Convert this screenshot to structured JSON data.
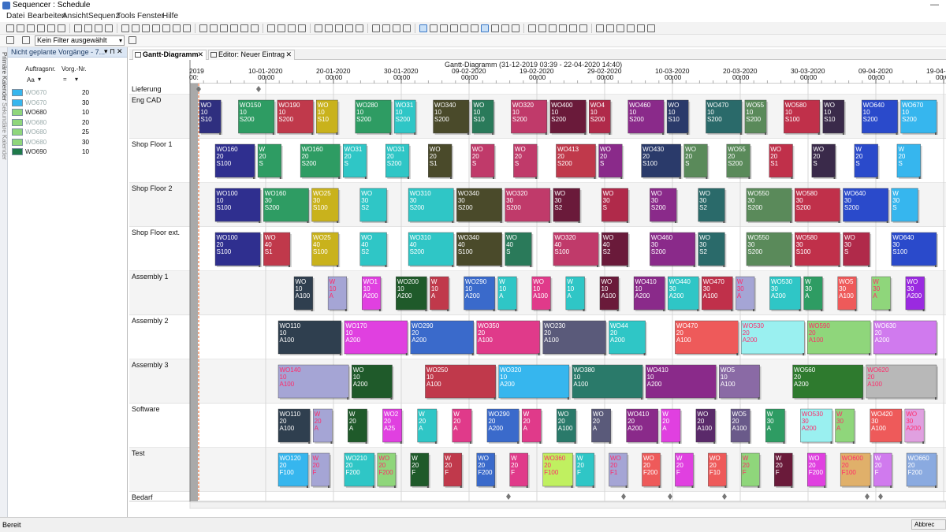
{
  "window": {
    "title": "Sequencer : Schedule"
  },
  "menu": [
    "Datei",
    "Bearbeiten",
    "Ansicht",
    "Sequenz",
    "Tools",
    "Fenster",
    "Hilfe"
  ],
  "filter": {
    "value": "Kein Filter ausgewählt"
  },
  "side_strip": {
    "primary": "Primäre Kalender",
    "secondary": "Sekundäre Kalender"
  },
  "left_panel": {
    "title": "Nicht geplante Vorgänge - 7...",
    "col_order": "Auftragsnr.",
    "col_step": "Vorg.-Nr.",
    "filter_order": "Aa",
    "filter_step": "=",
    "rows": [
      {
        "order": "WO670",
        "step": "20",
        "color": "#36b6ee",
        "dim": true
      },
      {
        "order": "WO670",
        "step": "30",
        "color": "#36b6ee",
        "dim": true
      },
      {
        "order": "WO680",
        "step": "10",
        "color": "#8fd67b",
        "dim": false
      },
      {
        "order": "WO680",
        "step": "20",
        "color": "#8fd67b",
        "dim": true
      },
      {
        "order": "WO680",
        "step": "25",
        "color": "#8fd67b",
        "dim": true
      },
      {
        "order": "WO680",
        "step": "30",
        "color": "#8fd67b",
        "dim": true
      },
      {
        "order": "WO690",
        "step": "10",
        "color": "#1f7a4a",
        "dim": false
      }
    ]
  },
  "tabs": [
    {
      "label": "Gantt-Diagramm",
      "active": true
    },
    {
      "label": "Editor: Neuer Eintrag",
      "active": false
    }
  ],
  "gantt": {
    "title": "Gantt-Diagramm   (31-12-2019 03:39 - 22-04-2020 14:40)",
    "dates": [
      {
        "date": "2019",
        "time": "00:"
      },
      {
        "date": "10-01-2020",
        "time": "00:00"
      },
      {
        "date": "20-01-2020",
        "time": "00:00"
      },
      {
        "date": "30-01-2020",
        "time": "00:00"
      },
      {
        "date": "09-02-2020",
        "time": "00:00"
      },
      {
        "date": "19-02-2020",
        "time": "00:00"
      },
      {
        "date": "29-02-2020",
        "time": "00:00"
      },
      {
        "date": "10-03-2020",
        "time": "00:00"
      },
      {
        "date": "20-03-2020",
        "time": "00:00"
      },
      {
        "date": "30-03-2020",
        "time": "00:00"
      },
      {
        "date": "09-04-2020",
        "time": "00:00"
      },
      {
        "date": "19-04-2020",
        "time": "00:00"
      }
    ],
    "rows": [
      "Lieferung",
      "Eng CAD",
      "Shop Floor 1",
      "Shop Floor 2",
      "Shop Floor ext.",
      "Assembly 1",
      "Assembly 2",
      "Assembly 3",
      "Software",
      "Test",
      "Bedarf"
    ],
    "lanes": {
      "Eng CAD": [
        [
          "WO",
          "10",
          "S10",
          "#2f2f7f"
        ],
        [
          "WO150",
          "10",
          "S200",
          "#2e9c63"
        ],
        [
          "WO190",
          "10",
          "S200",
          "#c0394b"
        ],
        [
          "WO",
          "10",
          "S10",
          "#c9b21c"
        ],
        [
          "WO280",
          "10",
          "S200",
          "#2e9c63"
        ],
        [
          "WO31",
          "10",
          "S200",
          "#2fc6c6"
        ],
        [
          "WO340",
          "10",
          "S200",
          "#4a4a2a"
        ],
        [
          "WO",
          "10",
          "S10",
          "#2a7a5a"
        ],
        [
          "WO320",
          "10",
          "S200",
          "#c03a6a"
        ],
        [
          "WO400",
          "10",
          "S200",
          "#6a1a3a"
        ],
        [
          "WO4",
          "10",
          "S200",
          "#b02a4a"
        ],
        [
          "WO460",
          "10",
          "S200",
          "#8a2a8a"
        ],
        [
          "WO",
          "10",
          "S10",
          "#2a3a6a"
        ],
        [
          "WO470",
          "10",
          "S200",
          "#2a6a6a"
        ],
        [
          "WO55",
          "10",
          "S200",
          "#5a8a5a"
        ],
        [
          "WO580",
          "10",
          "S100",
          "#c0304a"
        ],
        [
          "WO",
          "10",
          "S10",
          "#3a2a4a"
        ],
        [
          "WO640",
          "10",
          "S200",
          "#2a4acb"
        ],
        [
          "WO670",
          "10",
          "S200",
          "#36b6ee"
        ]
      ],
      "Shop Floor 1": [
        [
          "WO160",
          "20",
          "S100",
          "#2f2f8f"
        ],
        [
          "W",
          "20",
          "S",
          "#2e9c63"
        ],
        [
          "WO160",
          "20",
          "S200",
          "#2e9c63"
        ],
        [
          "WO31",
          "20",
          "S",
          "#2fc6c6"
        ],
        [
          "WO31",
          "20",
          "S200",
          "#2fc6c6"
        ],
        [
          "WO",
          "20",
          "S1",
          "#4a4a2a"
        ],
        [
          "WO",
          "20",
          "S",
          "#c03a6a"
        ],
        [
          "WO",
          "20",
          "S",
          "#c03a6a"
        ],
        [
          "WO413",
          "20",
          "S200",
          "#c0394b"
        ],
        [
          "WO",
          "20",
          "S",
          "#8a2a8a"
        ],
        [
          "WO430",
          "20",
          "S100",
          "#2a3a6a"
        ],
        [
          "WO",
          "20",
          "S",
          "#5a8a5a"
        ],
        [
          "WO55",
          "20",
          "S200",
          "#5a8a5a"
        ],
        [
          "WO",
          "20",
          "S1",
          "#c0304a"
        ],
        [
          "WO",
          "20",
          "S",
          "#3a2a4a"
        ],
        [
          "W",
          "20",
          "S",
          "#2a4acb"
        ],
        [
          "W",
          "20",
          "S",
          "#36b6ee"
        ]
      ],
      "Shop Floor 2": [
        [
          "WO100",
          "10",
          "S100",
          "#2f2f8f"
        ],
        [
          "WO160",
          "30",
          "S200",
          "#2e9c63"
        ],
        [
          "WO25",
          "30",
          "S100",
          "#c9b21c"
        ],
        [
          "WO",
          "30",
          "S2",
          "#2fc6c6"
        ],
        [
          "WO310",
          "30",
          "S200",
          "#2fc6c6"
        ],
        [
          "WO340",
          "30",
          "S200",
          "#4a4a2a"
        ],
        [
          "WO320",
          "30",
          "S200",
          "#c03a6a"
        ],
        [
          "WO",
          "30",
          "S2",
          "#6a1a3a"
        ],
        [
          "WO",
          "30",
          "S",
          "#b02a4a"
        ],
        [
          "WO",
          "30",
          "S200",
          "#8a2a8a"
        ],
        [
          "WO",
          "30",
          "S2",
          "#2a6a6a"
        ],
        [
          "WO550",
          "30",
          "S200",
          "#5a8a5a"
        ],
        [
          "WO580",
          "30",
          "S200",
          "#c0304a"
        ],
        [
          "WO640",
          "30",
          "S200",
          "#2a4acb"
        ],
        [
          "W",
          "30",
          "S",
          "#36b6ee"
        ]
      ],
      "Shop Floor ext.": [
        [
          "WO100",
          "20",
          "S100",
          "#2f2f8f"
        ],
        [
          "WO",
          "40",
          "S1",
          "#c0394b"
        ],
        [
          "WO25",
          "40",
          "S100",
          "#c9b21c"
        ],
        [
          "WO",
          "40",
          "S2",
          "#2fc6c6"
        ],
        [
          "WO310",
          "40",
          "S200",
          "#2fc6c6"
        ],
        [
          "WO340",
          "40",
          "S100",
          "#4a4a2a"
        ],
        [
          "WO",
          "40",
          "S",
          "#2a7a5a"
        ],
        [
          "WO320",
          "40",
          "S100",
          "#c03a6a"
        ],
        [
          "WO",
          "40",
          "S2",
          "#6a1a3a"
        ],
        [
          "WO460",
          "30",
          "S200",
          "#8a2a8a"
        ],
        [
          "WO",
          "30",
          "S2",
          "#2a6a6a"
        ],
        [
          "WO550",
          "30",
          "S200",
          "#5a8a5a"
        ],
        [
          "WO580",
          "30",
          "S100",
          "#c0304a"
        ],
        [
          "WO",
          "30",
          "S",
          "#b02a4a"
        ],
        [
          "WO640",
          "30",
          "S100",
          "#2a4acb"
        ]
      ],
      "Assembly 1": [
        [
          "WO",
          "10",
          "A100",
          "#2f3f4f"
        ],
        [
          "W",
          "10",
          "A",
          "#a5a5d5"
        ],
        [
          "WO1",
          "10",
          "A200",
          "#e040e0"
        ],
        [
          "WO200",
          "10",
          "A200",
          "#1f5a2a"
        ],
        [
          "W",
          "10",
          "A",
          "#c0394b"
        ],
        [
          "WO290",
          "10",
          "A200",
          "#3a6acb"
        ],
        [
          "W",
          "10",
          "A",
          "#2fc6c6"
        ],
        [
          "WO",
          "10",
          "A100",
          "#e03a8a"
        ],
        [
          "W",
          "10",
          "A",
          "#2fc6c6"
        ],
        [
          "WO",
          "10",
          "A100",
          "#6a1a3a"
        ],
        [
          "WO410",
          "10",
          "A200",
          "#8a2a8a"
        ],
        [
          "WO440",
          "30",
          "A200",
          "#2fc6c6"
        ],
        [
          "WO470",
          "30",
          "A100",
          "#c0304a"
        ],
        [
          "W",
          "30",
          "A",
          "#a5a5d5"
        ],
        [
          "WO530",
          "30",
          "A200",
          "#2fc6c6"
        ],
        [
          "W",
          "30",
          "A",
          "#2e9c63"
        ],
        [
          "WO5",
          "30",
          "A100",
          "#ee5a5a"
        ],
        [
          "W",
          "30",
          "A",
          "#8fd67b"
        ],
        [
          "WO",
          "30",
          "A200",
          "#9a2ae0"
        ]
      ],
      "Assembly 2": [
        [
          "WO110",
          "10",
          "A100",
          "#2f3f4f"
        ],
        [
          "WO170",
          "10",
          "A200",
          "#e040e0"
        ],
        [
          "WO290",
          "20",
          "A200",
          "#3a6acb"
        ],
        [
          "WO350",
          "20",
          "A100",
          "#e03a8a"
        ],
        [
          "WO230",
          "20",
          "A100",
          "#5a5a7a"
        ],
        [
          "WO44",
          "20",
          "A200",
          "#2fc6c6"
        ],
        [
          "WO470",
          "20",
          "A100",
          "#ee5a5a"
        ],
        [
          "WO530",
          "20",
          "A200",
          "#9af0f0"
        ],
        [
          "WO590",
          "20",
          "A100",
          "#8fd67b"
        ],
        [
          "WO630",
          "20",
          "A200",
          "#d07aee"
        ]
      ],
      "Assembly 3": [
        [
          "WO140",
          "10",
          "A100",
          "#a5a5d5"
        ],
        [
          "WO",
          "10",
          "A200",
          "#1f5a2a"
        ],
        [
          "WO250",
          "10",
          "A100",
          "#c0394b"
        ],
        [
          "WO320",
          "10",
          "A200",
          "#36b6ee"
        ],
        [
          "WO380",
          "10",
          "A100",
          "#2a7a6a"
        ],
        [
          "WO410",
          "10",
          "A200",
          "#8a2a8a"
        ],
        [
          "WO5",
          "10",
          "A100",
          "#8a6aa5"
        ],
        [
          "WO560",
          "20",
          "A200",
          "#2e7a2e"
        ],
        [
          "WO620",
          "20",
          "A100",
          "#b8b8b8"
        ]
      ],
      "Software": [
        [
          "WO110",
          "20",
          "A100",
          "#2f3f4f"
        ],
        [
          "W",
          "20",
          "A",
          "#a5a5d5"
        ],
        [
          "W",
          "20",
          "A",
          "#1f5a2a"
        ],
        [
          "WO2",
          "20",
          "A25",
          "#e040e0"
        ],
        [
          "W",
          "20",
          "A",
          "#2fc6c6"
        ],
        [
          "W",
          "20",
          "A",
          "#e03a8a"
        ],
        [
          "WO290",
          "20",
          "A200",
          "#3a6acb"
        ],
        [
          "W",
          "20",
          "A",
          "#e03a8a"
        ],
        [
          "WO",
          "20",
          "A100",
          "#2a7a6a"
        ],
        [
          "WO",
          "20",
          "A",
          "#5a5a7a"
        ],
        [
          "WO410",
          "20",
          "A200",
          "#8a2a8a"
        ],
        [
          "W",
          "20",
          "A",
          "#e040e0"
        ],
        [
          "WO",
          "20",
          "A100",
          "#5a2a6a"
        ],
        [
          "WO5",
          "20",
          "A100",
          "#6a5a8a"
        ],
        [
          "W",
          "30",
          "A",
          "#2e9c63"
        ],
        [
          "WO530",
          "30",
          "A200",
          "#9af0f0"
        ],
        [
          "W",
          "30",
          "A",
          "#8fd67b"
        ],
        [
          "WO420",
          "30",
          "A100",
          "#ee5a5a"
        ],
        [
          "WO",
          "30",
          "A200",
          "#e0a0e0"
        ]
      ],
      "Test": [
        [
          "WO120",
          "20",
          "F100",
          "#36b6ee"
        ],
        [
          "W",
          "20",
          "F",
          "#a5a5d5"
        ],
        [
          "WO210",
          "20",
          "F200",
          "#2fc6c6"
        ],
        [
          "WO",
          "20",
          "F200",
          "#8fd67b"
        ],
        [
          "W",
          "20",
          "F",
          "#1f5a2a"
        ],
        [
          "W",
          "20",
          "F",
          "#c0394b"
        ],
        [
          "WO",
          "20",
          "F200",
          "#3a6acb"
        ],
        [
          "W",
          "20",
          "F",
          "#e03a8a"
        ],
        [
          "WO360",
          "20",
          "F100",
          "#c0f060"
        ],
        [
          "W",
          "20",
          "F",
          "#2fc6c6"
        ],
        [
          "WO",
          "20",
          "F1",
          "#a5a5d5"
        ],
        [
          "WO",
          "20",
          "F200",
          "#ee5a5a"
        ],
        [
          "W",
          "20",
          "F",
          "#e040e0"
        ],
        [
          "WO",
          "20",
          "F10",
          "#ee5a5a"
        ],
        [
          "W",
          "20",
          "F",
          "#8fd67b"
        ],
        [
          "W",
          "20",
          "F",
          "#6a1a3a"
        ],
        [
          "WO",
          "20",
          "F200",
          "#e040e0"
        ],
        [
          "WO600",
          "20",
          "F100",
          "#e0b06a"
        ],
        [
          "W",
          "20",
          "F",
          "#d07aee"
        ],
        [
          "WO660",
          "20",
          "F200",
          "#8aaae0"
        ]
      ]
    },
    "lieferung_markers": 2,
    "bedarf_markers": 7
  },
  "toolbar": {
    "icon_count": 58
  },
  "status": {
    "left": "Bereit",
    "right": "Abbrec"
  }
}
